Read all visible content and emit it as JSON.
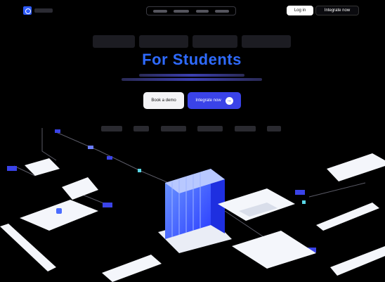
{
  "nav": {
    "login_label": "Log in",
    "integrate_label": "Integrate now"
  },
  "hero": {
    "subheadline": "For Students"
  },
  "cta": {
    "demo_label": "Book a demo",
    "integrate_label": "Integrate now",
    "integrate_icon": "arrow-right-icon"
  },
  "colors": {
    "background": "#000000",
    "accent": "#2f6bff",
    "button_primary": "#3a43e8"
  }
}
